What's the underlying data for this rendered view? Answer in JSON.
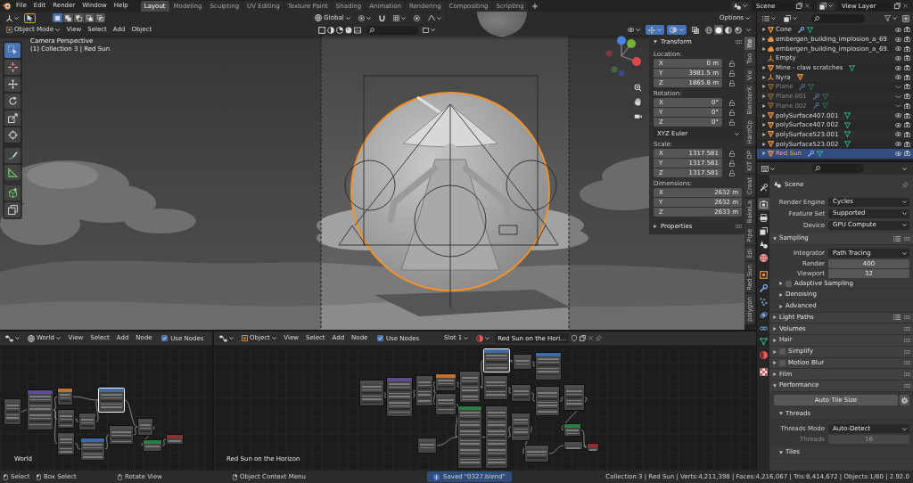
{
  "topbar": {
    "menus": [
      "File",
      "Edit",
      "Render",
      "Window",
      "Help"
    ],
    "workspaces": [
      {
        "label": "Layout",
        "selected": true
      },
      {
        "label": "Modeling",
        "selected": false
      },
      {
        "label": "Sculpting",
        "selected": false
      },
      {
        "label": "UV Editing",
        "selected": false
      },
      {
        "label": "Texture Paint",
        "selected": false
      },
      {
        "label": "Shading",
        "selected": false
      },
      {
        "label": "Animation",
        "selected": false
      },
      {
        "label": "Rendering",
        "selected": false
      },
      {
        "label": "Compositing",
        "selected": false
      },
      {
        "label": "Scripting",
        "selected": false
      }
    ],
    "scene": "Scene",
    "view_layer": "View Layer"
  },
  "viewport": {
    "tool_header": {
      "select_modes": [
        {
          "selected": true
        },
        {
          "selected": false
        },
        {
          "selected": false
        },
        {
          "selected": false
        },
        {
          "selected": false
        }
      ],
      "orientation": "Global",
      "options": "Options"
    },
    "header": {
      "mode": "Object Mode",
      "menus": [
        "View",
        "Select",
        "Add",
        "Object"
      ],
      "gizmos_on": true,
      "overlays_on": true,
      "xray_on": false,
      "shading_modes": [
        {
          "selected": false
        },
        {
          "selected": true
        },
        {
          "selected": false
        },
        {
          "selected": false
        }
      ]
    },
    "info_text": [
      "Camera Perspective",
      "(1) Collection 3 | Red Sun"
    ],
    "tools": [
      {
        "selected": true
      },
      {
        "selected": false
      },
      {
        "selected": false
      },
      {
        "selected": false
      },
      {
        "selected": false
      },
      {
        "selected": false
      },
      {
        "selected": false
      },
      {
        "selected": false
      },
      {
        "selected": false
      },
      {
        "selected": false
      }
    ],
    "sidebar": {
      "tabs": [
        {
          "label": "Ite",
          "selected": true
        },
        {
          "label": "Too",
          "selected": false
        },
        {
          "label": "Vie",
          "selected": false
        },
        {
          "label": "BlenderK",
          "selected": false
        },
        {
          "label": "HardOp",
          "selected": false
        },
        {
          "label": "KIT OP",
          "selected": false
        },
        {
          "label": "Creat",
          "selected": false
        },
        {
          "label": "BakeLa",
          "selected": false
        },
        {
          "label": "Pipe",
          "selected": false
        },
        {
          "label": "Edi",
          "selected": false
        },
        {
          "label": "Red Sun",
          "selected": false
        },
        {
          "label": "polygon",
          "selected": false
        }
      ],
      "panels": [
        {
          "title": "Transform",
          "expanded": true,
          "groups": [
            {
              "label": "Location:",
              "fields": [
                {
                  "axis": "X",
                  "value": "0 m",
                  "locked": false
                },
                {
                  "axis": "Y",
                  "value": "3981.5 m",
                  "locked": false
                },
                {
                  "axis": "Z",
                  "value": "1865.8 m",
                  "locked": false
                }
              ]
            },
            {
              "label": "Rotation:",
              "fields": [
                {
                  "axis": "X",
                  "value": "0°",
                  "locked": false
                },
                {
                  "axis": "Y",
                  "value": "0°",
                  "locked": false
                },
                {
                  "axis": "Z",
                  "value": "0°",
                  "locked": false
                }
              ],
              "mode": "XYZ Euler"
            },
            {
              "label": "Scale:",
              "fields": [
                {
                  "axis": "X",
                  "value": "1317.581",
                  "locked": false
                },
                {
                  "axis": "Y",
                  "value": "1317.581",
                  "locked": false
                },
                {
                  "axis": "Z",
                  "value": "1317.581",
                  "locked": false
                }
              ]
            },
            {
              "label": "Dimensions:",
              "fields": [
                {
                  "axis": "X",
                  "value": "2632 m"
                },
                {
                  "axis": "Y",
                  "value": "2632 m"
                },
                {
                  "axis": "Z",
                  "value": "2633 m"
                }
              ]
            }
          ]
        },
        {
          "title": "Properties",
          "expanded": false
        }
      ]
    }
  },
  "outliner": {
    "rows": [
      {
        "name": "Cone",
        "kind": "mesh",
        "expandable": true,
        "modifier": true,
        "mesh_data": true,
        "child": false,
        "visible": true,
        "selected": false
      },
      {
        "name": "embergen_building_implosion_a_69",
        "kind": "volume",
        "expandable": true,
        "modifier": false,
        "mesh_data": false,
        "child": false,
        "visible": true,
        "selected": false
      },
      {
        "name": "embergen_building_implosion_a_69.",
        "kind": "volume",
        "expandable": true,
        "modifier": false,
        "mesh_data": false,
        "child": false,
        "visible": true,
        "selected": false
      },
      {
        "name": "Empty",
        "kind": "empty",
        "expandable": false,
        "modifier": false,
        "mesh_data": false,
        "child": false,
        "visible": true,
        "selected": false
      },
      {
        "name": "Mine - claw scratches",
        "kind": "mesh",
        "expandable": true,
        "modifier": false,
        "mesh_data": true,
        "child": false,
        "visible": true,
        "selected": false
      },
      {
        "name": "Nyra",
        "kind": "empty",
        "expandable": true,
        "modifier": false,
        "mesh_data": false,
        "child": true,
        "visible": true,
        "selected": false
      },
      {
        "name": "Plane",
        "kind": "mesh",
        "expandable": true,
        "modifier": true,
        "mesh_data": true,
        "child": false,
        "visible": false,
        "selected": false
      },
      {
        "name": "Plane.001",
        "kind": "mesh",
        "expandable": true,
        "modifier": true,
        "mesh_data": true,
        "child": false,
        "visible": false,
        "selected": false
      },
      {
        "name": "Plane.002",
        "kind": "mesh",
        "expandable": true,
        "modifier": true,
        "mesh_data": true,
        "child": false,
        "visible": false,
        "selected": false
      },
      {
        "name": "polySurface407.001",
        "kind": "mesh",
        "expandable": true,
        "modifier": false,
        "mesh_data": true,
        "child": false,
        "visible": true,
        "selected": false
      },
      {
        "name": "polySurface407.002",
        "kind": "mesh",
        "expandable": true,
        "modifier": false,
        "mesh_data": true,
        "child": false,
        "visible": true,
        "selected": false
      },
      {
        "name": "polySurface523.001",
        "kind": "mesh",
        "expandable": true,
        "modifier": false,
        "mesh_data": true,
        "child": false,
        "visible": true,
        "selected": false
      },
      {
        "name": "polySurface523.002",
        "kind": "mesh",
        "expandable": true,
        "modifier": false,
        "mesh_data": true,
        "child": false,
        "visible": true,
        "selected": false
      },
      {
        "name": "Red Sun",
        "kind": "mesh",
        "expandable": true,
        "modifier": true,
        "mesh_data": true,
        "child": false,
        "visible": true,
        "selected": true
      }
    ]
  },
  "properties": {
    "tabs": [
      {
        "selected": false
      },
      {
        "selected": true
      },
      {
        "selected": false
      },
      {
        "selected": false
      },
      {
        "selected": false
      },
      {
        "selected": false
      },
      {
        "selected": false
      },
      {
        "selected": false
      },
      {
        "selected": false
      },
      {
        "selected": false
      },
      {
        "selected": false
      },
      {
        "selected": false
      },
      {
        "selected": false
      },
      {
        "selected": false
      }
    ],
    "context": "Scene",
    "fields": [
      {
        "label": "Render Engine",
        "value": "Cycles"
      },
      {
        "label": "Feature Set",
        "value": "Supported"
      },
      {
        "label": "Device",
        "value": "GPU Compute"
      }
    ],
    "panels": [
      {
        "title": "Sampling",
        "expanded": true,
        "presets": true,
        "items": [
          {
            "kind": "dropdown",
            "label": "Integrator",
            "value": "Path Tracing"
          },
          {
            "kind": "number",
            "label": "Render",
            "value": "400"
          },
          {
            "kind": "number",
            "label": "Viewport",
            "value": "32"
          },
          {
            "kind": "subpanel",
            "title": "Adaptive Sampling",
            "expanded": false,
            "checked": false
          },
          {
            "kind": "subpanel",
            "title": "Denoising",
            "expanded": false
          },
          {
            "kind": "subpanel",
            "title": "Advanced",
            "expanded": false
          }
        ]
      },
      {
        "title": "Light Paths",
        "expanded": false,
        "presets": true
      },
      {
        "title": "Volumes",
        "expanded": false
      },
      {
        "title": "Hair",
        "expanded": false
      },
      {
        "title": "Simplify",
        "expanded": false,
        "checked": false
      },
      {
        "title": "Motion Blur",
        "expanded": false,
        "checked": false
      },
      {
        "title": "Film",
        "expanded": false
      },
      {
        "title": "Performance",
        "expanded": true,
        "items": [
          {
            "kind": "button",
            "label": "Auto Tile Size"
          },
          {
            "kind": "subpanel",
            "title": "Threads",
            "expanded": true,
            "items": [
              {
                "kind": "dropdown",
                "label": "Threads Mode",
                "value": "Auto-Detect"
              },
              {
                "kind": "number",
                "label": "Threads",
                "value": "16",
                "disabled": true
              }
            ]
          },
          {
            "kind": "subpanel",
            "title": "Tiles",
            "expanded": true
          }
        ]
      }
    ]
  },
  "node_editors": [
    {
      "kind": "world",
      "header": {
        "datablock": "World",
        "menus": [
          "View",
          "Select",
          "Add",
          "Node"
        ],
        "use_nodes": true,
        "use_nodes_label": "Use Nodes"
      },
      "label": "World",
      "nodes": [
        {
          "color": "#4d4d4d",
          "selected": false
        },
        {
          "color": "#5e4b94",
          "selected": false
        },
        {
          "color": "#c0712f",
          "selected": false
        },
        {
          "color": "#4d4d4d",
          "selected": false
        },
        {
          "color": "#4d4d4d",
          "selected": false
        },
        {
          "color": "#4d4d4d",
          "selected": false
        },
        {
          "color": "#3d6ba8",
          "selected": true
        },
        {
          "color": "#3d6ba8",
          "selected": false
        },
        {
          "color": "#4d4d4d",
          "selected": false
        },
        {
          "color": "#4d4d4d",
          "selected": false
        },
        {
          "color": "#2f7d43",
          "selected": false
        },
        {
          "color": "#8c2f34",
          "selected": false
        }
      ]
    },
    {
      "kind": "object",
      "header": {
        "datablock": "Object",
        "menus": [
          "View",
          "Select",
          "Add",
          "Node"
        ],
        "use_nodes": true,
        "use_nodes_label": "Use Nodes",
        "slot": "Slot 1",
        "material": "Red Sun on the Hori…"
      },
      "label": "Red Sun on the Horizon",
      "nodes": [
        {
          "color": "#4d4d4d",
          "selected": false
        },
        {
          "color": "#5e4b94",
          "selected": false
        },
        {
          "color": "#4d4d4d",
          "selected": false
        },
        {
          "color": "#c0712f",
          "selected": false
        },
        {
          "color": "#4d4d4d",
          "selected": false
        },
        {
          "color": "#4d4d4d",
          "selected": false
        },
        {
          "color": "#3d6ba8",
          "selected": true
        },
        {
          "color": "#4d4d4d",
          "selected": false
        },
        {
          "color": "#3d6ba8",
          "selected": false
        },
        {
          "color": "#4d4d4d",
          "selected": false
        },
        {
          "color": "#4d4d4d",
          "selected": false
        },
        {
          "color": "#2f7d43",
          "selected": false
        },
        {
          "color": "#4d4d4d",
          "selected": false
        },
        {
          "color": "#4d4d4d",
          "selected": false
        },
        {
          "color": "#4d4d4d",
          "selected": false
        },
        {
          "color": "#4d4d4d",
          "selected": false
        },
        {
          "color": "#4d4d4d",
          "selected": false
        },
        {
          "color": "#2f7d43",
          "selected": false
        },
        {
          "color": "#4d4d4d",
          "selected": false
        },
        {
          "color": "#8c2f34",
          "selected": false
        },
        {
          "color": "#4d4d4d",
          "selected": false
        }
      ]
    }
  ],
  "status_bar": {
    "hints": [
      "Select",
      "Box Select",
      "Rotate View",
      "Object Context Menu"
    ],
    "message": "Saved \"0327.blend\"",
    "stats": "Collection 3 | Red Sun | Verts:4,211,398 | Faces:4,216,067 | Tris:8,414,672 | Objects:1/80 | 2.92.0"
  }
}
